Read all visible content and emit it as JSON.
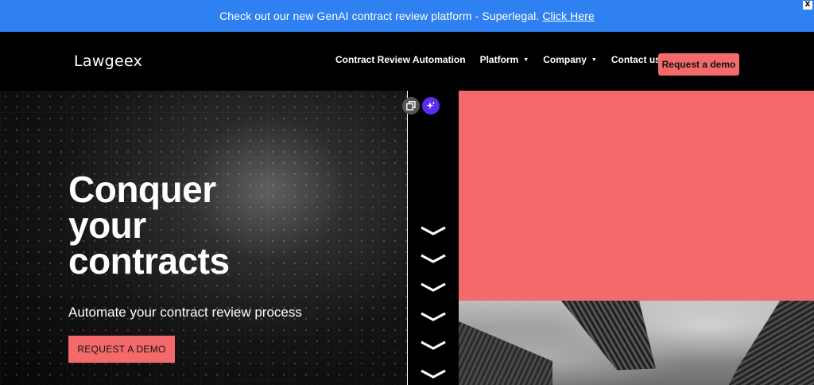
{
  "announcement": {
    "text": "Check out our new GenAI contract review platform - Superlegal.",
    "link_label": "Click Here",
    "close_label": "X"
  },
  "header": {
    "logo": "Lawgeex",
    "nav": [
      {
        "label": "Contract Review Automation",
        "has_dropdown": false
      },
      {
        "label": "Platform",
        "has_dropdown": true
      },
      {
        "label": "Company",
        "has_dropdown": true
      },
      {
        "label": "Contact us",
        "has_dropdown": false
      }
    ],
    "cta_label": "Request a demo"
  },
  "hero": {
    "title_lines": [
      "Conquer",
      "your",
      "contracts"
    ],
    "subtitle": "Automate your contract review process",
    "button_label": "REQUEST A DEMO"
  },
  "icons": {
    "caret": "caret-down-icon",
    "copy": "copy-icon",
    "ai": "sparkle-icon",
    "chevron": "chevron-down-icon"
  },
  "colors": {
    "announce_bg": "#2f80f0",
    "accent": "#f46a6a",
    "ai_button": "#5b2bf0"
  }
}
